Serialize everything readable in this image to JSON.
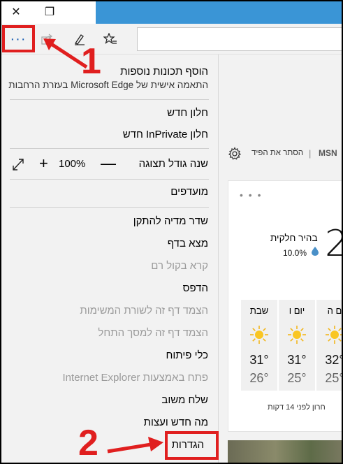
{
  "titlebar": {
    "close_glyph": "✕",
    "restore_glyph": "❐",
    "accent": "#3a95d6"
  },
  "toolbar": {
    "more_glyph": "···",
    "address_value": ""
  },
  "annotations": {
    "step1": "1",
    "step2": "2",
    "color": "#e01f1f"
  },
  "menu": {
    "add_features": "הוסף תכונות נוספות",
    "add_features_sub": "התאמה אישית של Microsoft Edge בעזרת הרחבות",
    "new_window": "חלון חדש",
    "new_inprivate": "חלון InPrivate חדש",
    "zoom_label": "שנה גודל תצוגה",
    "zoom_value": "100%",
    "zoom_plus": "+",
    "zoom_minus": "—",
    "favorites": "מועדפים",
    "cast": "שדר מדיה להתקן",
    "find": "מצא בדף",
    "read_aloud": "קרא בקול רם",
    "print": "הדפס",
    "pin_taskbar": "הצמד דף זה לשורת המשימות",
    "pin_start": "הצמד דף זה למסך התחל",
    "dev_tools": "כלי פיתוח",
    "open_ie": "פתח באמצעות Internet Explorer",
    "feedback": "שלח משוב",
    "whats_new": "מה חדש ועצות",
    "settings": "הגדרות"
  },
  "feed": {
    "brand": "MSN",
    "separator": "|",
    "hide_feed": "הסתר את הפיד"
  },
  "weather": {
    "menu_dots": "• • •",
    "temp_partial": "2",
    "condition": "בהיר חלקית",
    "precip": "10.0%",
    "days": [
      {
        "name": "ם ה",
        "hi": "32°",
        "lo": "25°"
      },
      {
        "name": "יום ו",
        "hi": "31°",
        "lo": "25°"
      },
      {
        "name": "שבת",
        "hi": "31°",
        "lo": "26°"
      }
    ],
    "updated": "חרון לפני 14 דקות"
  }
}
